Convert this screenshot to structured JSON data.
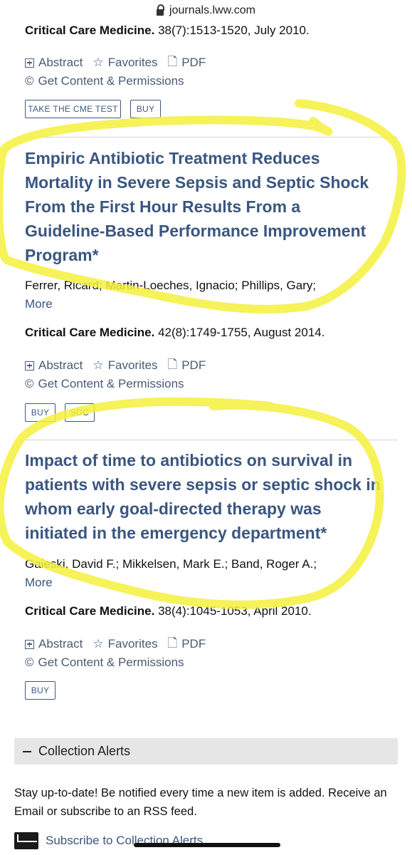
{
  "browser": {
    "url": "journals.lww.com"
  },
  "common": {
    "abstract": "Abstract",
    "favorites": "Favorites",
    "pdf": "PDF",
    "permissions": "Get Content & Permissions",
    "more": "More",
    "journal_name": "Critical Care Medicine."
  },
  "entry0": {
    "citation": " 38(7):1513-1520, July 2010.",
    "buttons": [
      "TAKE THE CME TEST",
      "BUY"
    ]
  },
  "entry1": {
    "title": "Empiric Antibiotic Treatment Reduces Mortality in Severe Sepsis and Septic Shock From the First Hour Results From a Guideline-Based Performance Improvement Program*",
    "authors": "Ferrer, Ricard; Martin-Loeches, Ignacio; Phillips, Gary;",
    "citation": " 42(8):1749-1755, August 2014.",
    "buttons": [
      "BUY",
      "SDC"
    ]
  },
  "entry2": {
    "title": "Impact of time to antibiotics on survival in patients with severe sepsis or septic shock in whom early goal-directed therapy was initiated in the emergency department*",
    "authors": "Gaieski, David F.; Mikkelsen, Mark E.; Band, Roger A.;",
    "citation": " 38(4):1045-1053, April 2010.",
    "buttons": [
      "BUY"
    ]
  },
  "alerts": {
    "header": "Collection Alerts",
    "description": "Stay up-to-date! Be notified every time a new item is added. Receive an Email or subscribe to an RSS feed.",
    "subscribe": "Subscribe to Collection Alerts"
  },
  "colors": {
    "link": "#3a5680",
    "highlight": "#f4f03c"
  }
}
